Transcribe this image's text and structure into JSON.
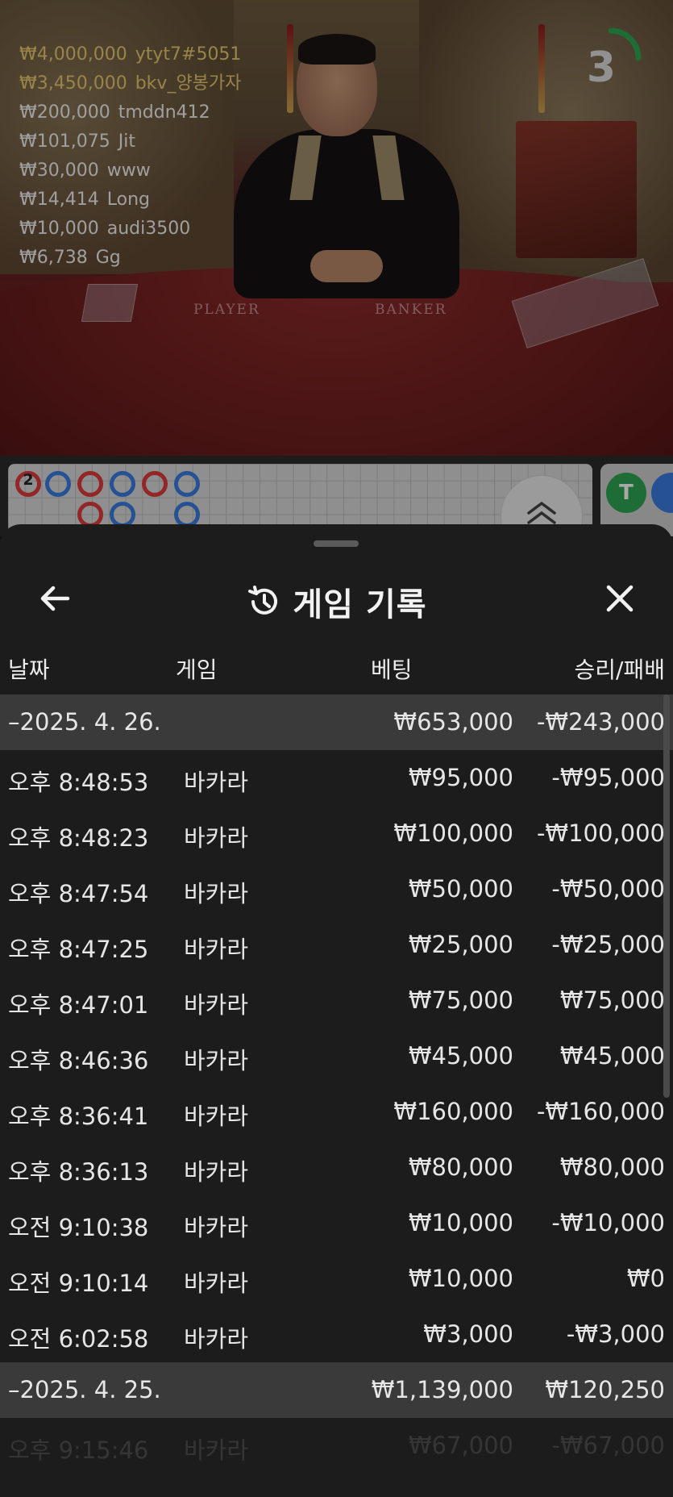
{
  "stream": {
    "timer_value": "3",
    "table_labels": {
      "player": "PLAYER",
      "banker": "BANKER"
    },
    "winners": [
      {
        "amount": "₩4,000,000",
        "name": "ytyt7#5051",
        "style": "gold"
      },
      {
        "amount": "₩3,450,000",
        "name": "bkv_양봉가자",
        "style": "gold"
      },
      {
        "amount": "₩200,000",
        "name": "tmddn412",
        "style": "white"
      },
      {
        "amount": "₩101,075",
        "name": "Jit",
        "style": "white"
      },
      {
        "amount": "₩30,000",
        "name": "www",
        "style": "white"
      },
      {
        "amount": "₩14,414",
        "name": "Long",
        "style": "white"
      },
      {
        "amount": "₩10,000",
        "name": "audi3500",
        "style": "white"
      },
      {
        "amount": "₩6,738",
        "name": "Gg",
        "style": "white"
      }
    ]
  },
  "roadmap": {
    "bead_count_label": "2",
    "side_label": "T"
  },
  "sheet": {
    "title": "게임 기록",
    "columns": {
      "date": "날짜",
      "game": "게임",
      "bet": "베팅",
      "winloss": "승리/패배"
    },
    "groups": [
      {
        "date": "–2025. 4. 26.",
        "bet_total": "₩653,000",
        "winloss_total": "-₩243,000",
        "rows": [
          {
            "time": "오후 8:48:53",
            "game": "바카라",
            "bet": "₩95,000",
            "winloss": "-₩95,000"
          },
          {
            "time": "오후 8:48:23",
            "game": "바카라",
            "bet": "₩100,000",
            "winloss": "-₩100,000"
          },
          {
            "time": "오후 8:47:54",
            "game": "바카라",
            "bet": "₩50,000",
            "winloss": "-₩50,000"
          },
          {
            "time": "오후 8:47:25",
            "game": "바카라",
            "bet": "₩25,000",
            "winloss": "-₩25,000"
          },
          {
            "time": "오후 8:47:01",
            "game": "바카라",
            "bet": "₩75,000",
            "winloss": "₩75,000"
          },
          {
            "time": "오후 8:46:36",
            "game": "바카라",
            "bet": "₩45,000",
            "winloss": "₩45,000"
          },
          {
            "time": "오후 8:36:41",
            "game": "바카라",
            "bet": "₩160,000",
            "winloss": "-₩160,000"
          },
          {
            "time": "오후 8:36:13",
            "game": "바카라",
            "bet": "₩80,000",
            "winloss": "₩80,000"
          },
          {
            "time": "오전 9:10:38",
            "game": "바카라",
            "bet": "₩10,000",
            "winloss": "-₩10,000"
          },
          {
            "time": "오전 9:10:14",
            "game": "바카라",
            "bet": "₩10,000",
            "winloss": "₩0"
          },
          {
            "time": "오전 6:02:58",
            "game": "바카라",
            "bet": "₩3,000",
            "winloss": "-₩3,000"
          }
        ]
      },
      {
        "date": "–2025. 4. 25.",
        "bet_total": "₩1,139,000",
        "winloss_total": "₩120,250",
        "rows": [
          {
            "time": "오후 9:15:46",
            "game": "바카라",
            "bet": "₩67,000",
            "winloss": "-₩67,000"
          }
        ]
      }
    ]
  }
}
